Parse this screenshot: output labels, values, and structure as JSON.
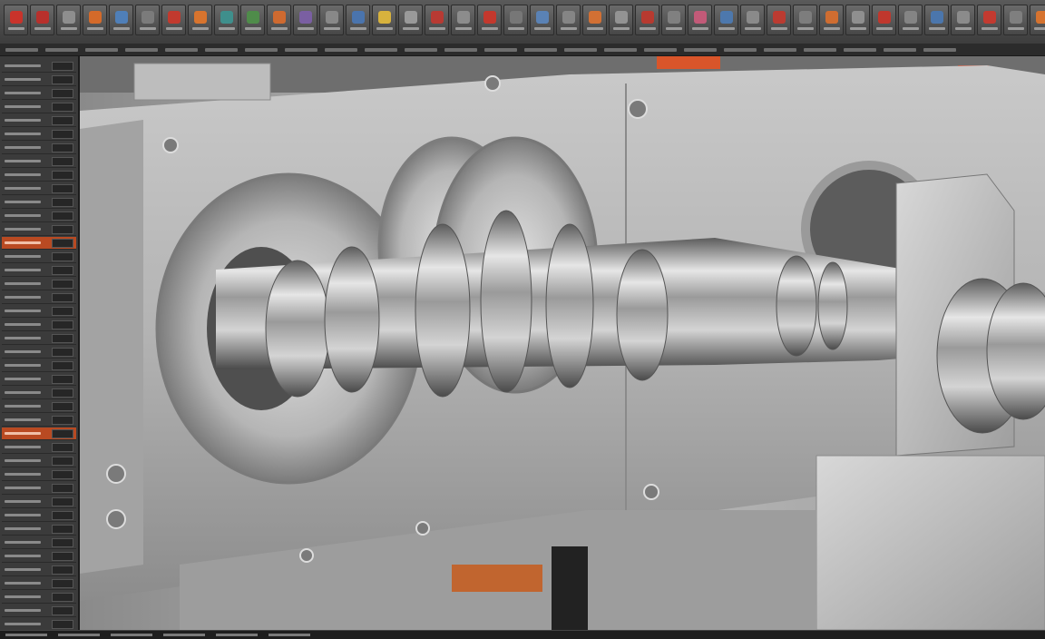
{
  "toolbar": {
    "tools": [
      {
        "icon": "red-shape-icon",
        "color": "#c9332b"
      },
      {
        "icon": "red-box-icon",
        "color": "#b8302c"
      },
      {
        "icon": "grey-sphere-icon",
        "color": "#8e8e8e"
      },
      {
        "icon": "orange-gear-icon",
        "color": "#d46a2a"
      },
      {
        "icon": "blue-panel-icon",
        "color": "#4f7fb8"
      },
      {
        "icon": "grey-disc-icon",
        "color": "#7b7b7b"
      },
      {
        "icon": "red-component-icon",
        "color": "#c23a2e"
      },
      {
        "icon": "orange-part-icon",
        "color": "#d8742e"
      },
      {
        "icon": "teal-view-icon",
        "color": "#3f8f8c"
      },
      {
        "icon": "green-assembly-icon",
        "color": "#4f8c4a"
      },
      {
        "icon": "orange-feature-icon",
        "color": "#cf6a30"
      },
      {
        "icon": "purple-tool-icon",
        "color": "#7a5fa2"
      },
      {
        "icon": "grey-sketch-icon",
        "color": "#888888"
      },
      {
        "icon": "blue-measure-icon",
        "color": "#4a74ad"
      },
      {
        "icon": "yellow-light-icon",
        "color": "#d7b23d"
      },
      {
        "icon": "grey-render-icon",
        "color": "#9a9a9a"
      },
      {
        "icon": "red-cut-icon",
        "color": "#b83a33"
      },
      {
        "icon": "grey-window-icon",
        "color": "#8c8c8c"
      },
      {
        "icon": "red-extrude-icon",
        "color": "#c3382d"
      },
      {
        "icon": "grey-layer-icon",
        "color": "#777777"
      },
      {
        "icon": "blue-mesh-icon",
        "color": "#5a82b5"
      },
      {
        "icon": "grey-shell-icon",
        "color": "#858585"
      },
      {
        "icon": "orange-fillet-icon",
        "color": "#d27034"
      },
      {
        "icon": "grey-mirror-icon",
        "color": "#939393"
      },
      {
        "icon": "red-pattern-icon",
        "color": "#b73a30"
      },
      {
        "icon": "grey-hole-icon",
        "color": "#808080"
      },
      {
        "icon": "pink-material-icon",
        "color": "#c25a78"
      },
      {
        "icon": "blue-camera-icon",
        "color": "#4d78ad"
      },
      {
        "icon": "grey-grid-icon",
        "color": "#8a8a8a"
      },
      {
        "icon": "red-constraint-icon",
        "color": "#bb3b31"
      },
      {
        "icon": "grey-axis-icon",
        "color": "#7d7d7d"
      },
      {
        "icon": "orange-weld-icon",
        "color": "#cf6d31"
      },
      {
        "icon": "grey-section-icon",
        "color": "#8f8f8f"
      },
      {
        "icon": "red-motion-icon",
        "color": "#c0372d"
      },
      {
        "icon": "grey-export-icon",
        "color": "#848484"
      },
      {
        "icon": "blue-settings-icon",
        "color": "#4b76ac"
      },
      {
        "icon": "grey-help-icon",
        "color": "#8b8b8b"
      },
      {
        "icon": "red-close-icon",
        "color": "#c33a30"
      },
      {
        "icon": "grey-more-icon",
        "color": "#7f7f7f"
      },
      {
        "icon": "orange-warning-icon",
        "color": "#d6732f"
      }
    ]
  },
  "colors": {
    "accent": "#d9552a",
    "steel_light": "#d6d6d6",
    "steel_mid": "#a9a9a9",
    "steel_dark": "#5c5c5c"
  },
  "viewport": {
    "subject": "rotating-shaft-assembly"
  }
}
